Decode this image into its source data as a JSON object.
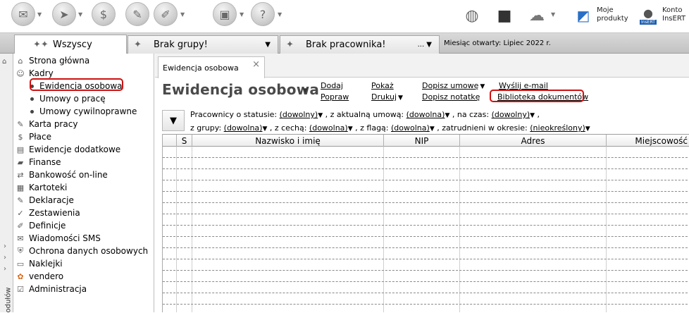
{
  "toolbar": {
    "icons": [
      "envelope-icon",
      "send-icon",
      "stack-icon",
      "notepad-icon",
      "edit-icon",
      "box-icon",
      "help-icon",
      "globe-icon",
      "cube-icon",
      "cloud-icon",
      "products-icon",
      "user-icon"
    ],
    "products_label_1": "Moje",
    "products_label_2": "produkty",
    "account_label_1": "Konto",
    "account_label_2": "InsERT",
    "avatar_badge": "InsERT"
  },
  "groupbar": {
    "tabs": [
      {
        "label": "Wszyscy",
        "active": true
      },
      {
        "label": "Brak grupy!",
        "dropdown": "▼"
      },
      {
        "label": "Brak pracownika!",
        "dropdown": "... ▼"
      }
    ],
    "month_label": "Miesiąc otwarty:",
    "month_value": "Lipiec 2022 r."
  },
  "sidebar": {
    "strip_label": "odułów",
    "items": [
      {
        "label": "Strona główna",
        "icon": "home-icon"
      },
      {
        "label": "Kadry",
        "icon": "people-icon"
      },
      {
        "label": "Ewidencja osobowa",
        "sub": true,
        "active": true
      },
      {
        "label": "Umowy o pracę",
        "sub": true
      },
      {
        "label": "Umowy cywilnoprawne",
        "sub": true
      },
      {
        "label": "Karta pracy",
        "icon": "card-icon"
      },
      {
        "label": "Płace",
        "icon": "money-icon"
      },
      {
        "label": "Ewidencje dodatkowe",
        "icon": "folder-icon"
      },
      {
        "label": "Finanse",
        "icon": "finance-icon"
      },
      {
        "label": "Bankowość on-line",
        "icon": "bank-icon"
      },
      {
        "label": "Kartoteki",
        "icon": "cards-icon"
      },
      {
        "label": "Deklaracje",
        "icon": "declaration-icon"
      },
      {
        "label": "Zestawienia",
        "icon": "report-icon"
      },
      {
        "label": "Definicje",
        "icon": "definition-icon"
      },
      {
        "label": "Wiadomości SMS",
        "icon": "sms-icon"
      },
      {
        "label": "Ochrona danych osobowych",
        "icon": "shield-icon"
      },
      {
        "label": "Naklejki",
        "icon": "sticker-icon"
      },
      {
        "label": "vendero",
        "icon": "vendero-icon"
      },
      {
        "label": "Administracja",
        "icon": "admin-icon"
      }
    ]
  },
  "content": {
    "tab_label": "Ewidencja osobowa",
    "tab_close": "×",
    "title": "Ewidencja osobowa",
    "actions": {
      "dodaj": "Dodaj",
      "popraw": "Popraw",
      "pokaz": "Pokaż",
      "drukuj": "Drukuj",
      "dopisz_umowe": "Dopisz umowę",
      "dopisz_notatke": "Dopisz notatkę",
      "wyslij_email": "Wyślij e-mail",
      "biblioteka": "Biblioteka dokumentów"
    },
    "filters": {
      "status_label": "Pracownicy o statusie:",
      "status_value": "(dowolny)",
      "umowa_label": ", z aktualną umową:",
      "umowa_value": "(dowolna)",
      "czas_label": ", na czas:",
      "czas_value": "(dowolny)",
      "czas_suffix": ",",
      "grupa_label": "z grupy:",
      "grupa_value": "(dowolna)",
      "cecha_label": ", z cechą:",
      "cecha_value": "(dowolna)",
      "flaga_label": ", z flagą:",
      "flaga_value": "(dowolna)",
      "okres_label": ", zatrudnieni w okresie:",
      "okres_value": "(nieokreślony)"
    },
    "grid": {
      "columns": [
        "S",
        "Nazwisko i imię",
        "NIP",
        "Adres",
        "Miejscowość"
      ]
    }
  },
  "colors": {
    "highlight_ring": "#d01010",
    "title_text": "#4a4a4a"
  }
}
